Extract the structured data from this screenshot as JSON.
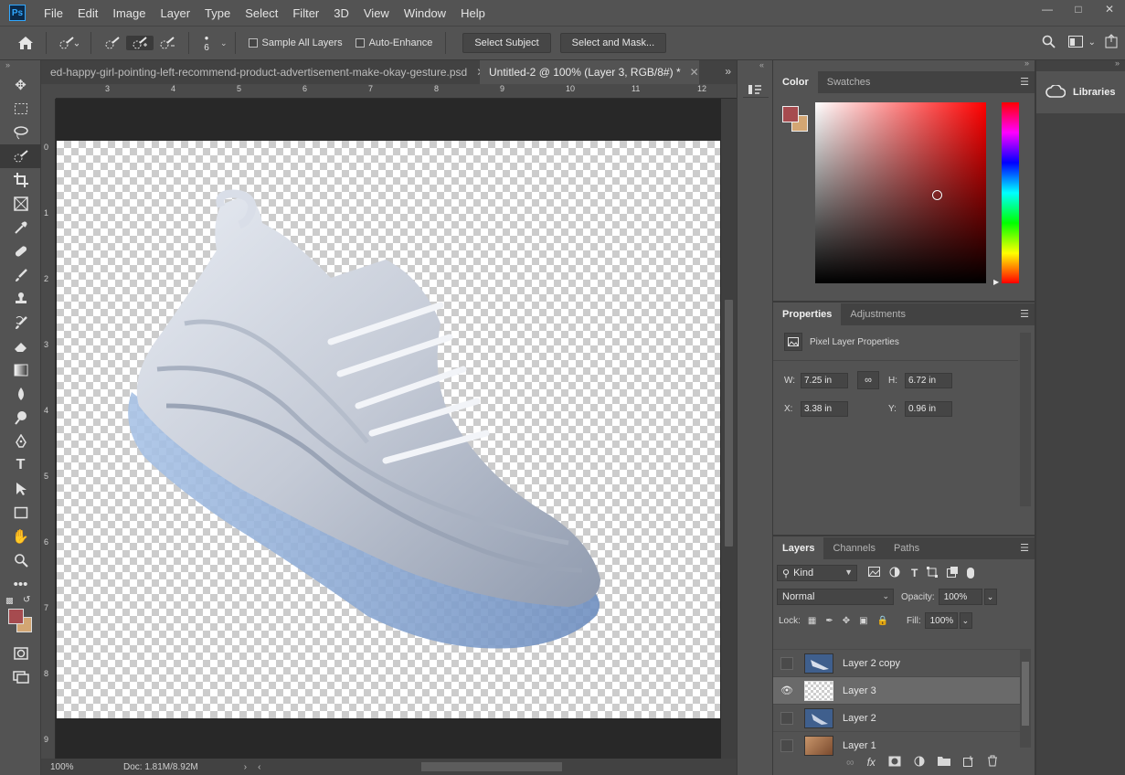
{
  "app": {
    "logo": "Ps",
    "menus": [
      "File",
      "Edit",
      "Image",
      "Layer",
      "Type",
      "Select",
      "Filter",
      "3D",
      "View",
      "Window",
      "Help"
    ],
    "window_controls": [
      "minimize",
      "maximize",
      "close"
    ]
  },
  "options_bar": {
    "brush_size": "6",
    "sample_all_layers": "Sample All Layers",
    "auto_enhance": "Auto-Enhance",
    "select_subject": "Select Subject",
    "select_and_mask": "Select and Mask..."
  },
  "tools": [
    "move-icon",
    "marquee-icon",
    "lasso-icon",
    "quick-selection-icon",
    "crop-icon",
    "frame-icon",
    "eyedropper-icon",
    "healing-icon",
    "brush-icon",
    "stamp-icon",
    "history-brush-icon",
    "eraser-icon",
    "gradient-icon",
    "blur-icon",
    "dodge-icon",
    "pen-icon",
    "type-icon",
    "path-selection-icon",
    "rectangle-icon",
    "hand-icon",
    "zoom-icon",
    "more-icon"
  ],
  "document": {
    "tabs": [
      {
        "label": "ed-happy-girl-pointing-left-recommend-product-advertisement-make-okay-gesture.psd",
        "active": false
      },
      {
        "label": "Untitled-2 @ 100% (Layer 3, RGB/8#) *",
        "active": true
      }
    ],
    "ruler_h": [
      "3",
      "4",
      "5",
      "6",
      "7",
      "8",
      "9",
      "10",
      "11",
      "12"
    ],
    "ruler_v": [
      "0",
      "1",
      "2",
      "3",
      "4",
      "5",
      "6",
      "7",
      "8",
      "9"
    ],
    "zoom": "100%",
    "doc_size": "Doc: 1.81M/8.92M"
  },
  "colors": {
    "foreground": "#a64b4f",
    "background": "#d3a673",
    "accent_hue": "#ff0000"
  },
  "color_panel": {
    "tabs": [
      "Color",
      "Swatches"
    ]
  },
  "properties_panel": {
    "tabs": [
      "Properties",
      "Adjustments"
    ],
    "title": "Pixel Layer Properties",
    "w_label": "W:",
    "w_value": "7.25 in",
    "h_label": "H:",
    "h_value": "6.72 in",
    "x_label": "X:",
    "x_value": "3.38 in",
    "y_label": "Y:",
    "y_value": "0.96 in"
  },
  "layers_panel": {
    "tabs": [
      "Layers",
      "Channels",
      "Paths"
    ],
    "filter_kind": "Kind",
    "blend_mode": "Normal",
    "opacity_label": "Opacity:",
    "opacity_value": "100%",
    "lock_label": "Lock:",
    "fill_label": "Fill:",
    "fill_value": "100%",
    "layers": [
      {
        "name": "Layer 2 copy",
        "visible": false,
        "selected": false
      },
      {
        "name": "Layer 3",
        "visible": true,
        "selected": true
      },
      {
        "name": "Layer 2",
        "visible": false,
        "selected": false
      },
      {
        "name": "Layer 1",
        "visible": false,
        "selected": false
      }
    ]
  },
  "libraries": {
    "label": "Libraries"
  }
}
